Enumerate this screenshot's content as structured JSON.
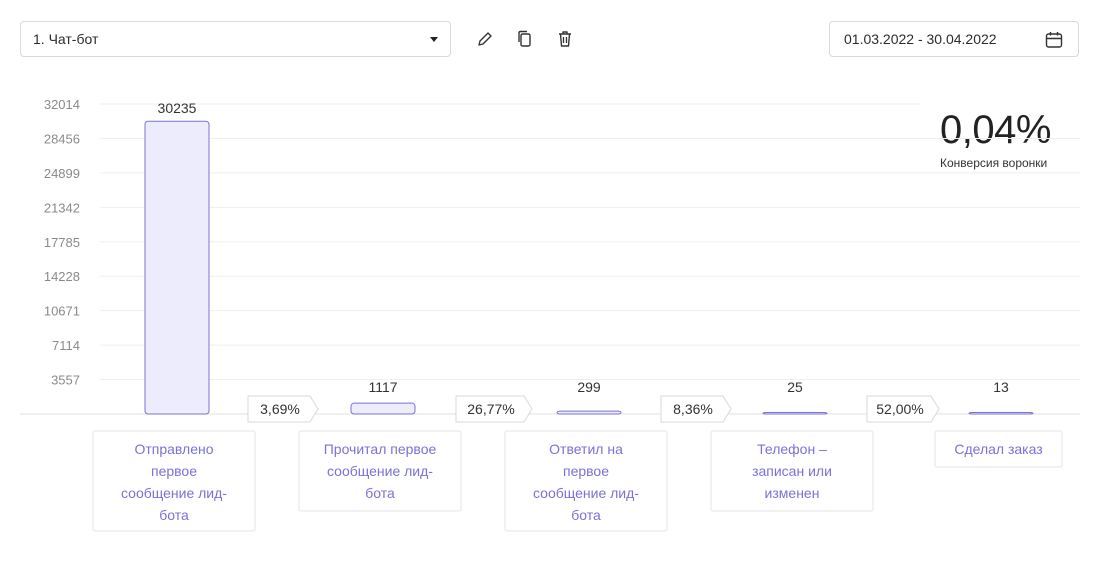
{
  "toolbar": {
    "funnel_select_value": "1. Чат-бот",
    "date_range": "01.03.2022 - 30.04.2022",
    "icons": [
      "pencil-icon",
      "copy-icon",
      "trash-icon",
      "calendar-icon"
    ]
  },
  "kpi": {
    "value": "0,04%",
    "label": "Конверсия воронки"
  },
  "chart_data": {
    "type": "bar",
    "categories": [
      [
        "Отправлено",
        "первое",
        "сообщение лид-",
        "бота"
      ],
      [
        "Прочитал первое",
        "сообщение лид-",
        "бота"
      ],
      [
        "Ответил на",
        "первое",
        "сообщение лид-",
        "бота"
      ],
      [
        "Телефон –",
        "записан или",
        "изменен"
      ],
      [
        "Сделал заказ"
      ]
    ],
    "values": [
      30235,
      1117,
      299,
      25,
      13
    ],
    "value_labels": [
      "30235",
      "1117",
      "299",
      "25",
      "13"
    ],
    "conversion_rates": [
      "3,69%",
      "26,77%",
      "8,36%",
      "52,00%"
    ],
    "y_ticks": [
      3557,
      7114,
      10671,
      14228,
      17785,
      21342,
      24899,
      28456,
      32014
    ],
    "ylim": [
      0,
      32014
    ],
    "grid": true,
    "colors": {
      "bar_fill": "#ececfc",
      "bar_stroke": "#7b71d8",
      "label_text": "#7b71d8"
    }
  }
}
